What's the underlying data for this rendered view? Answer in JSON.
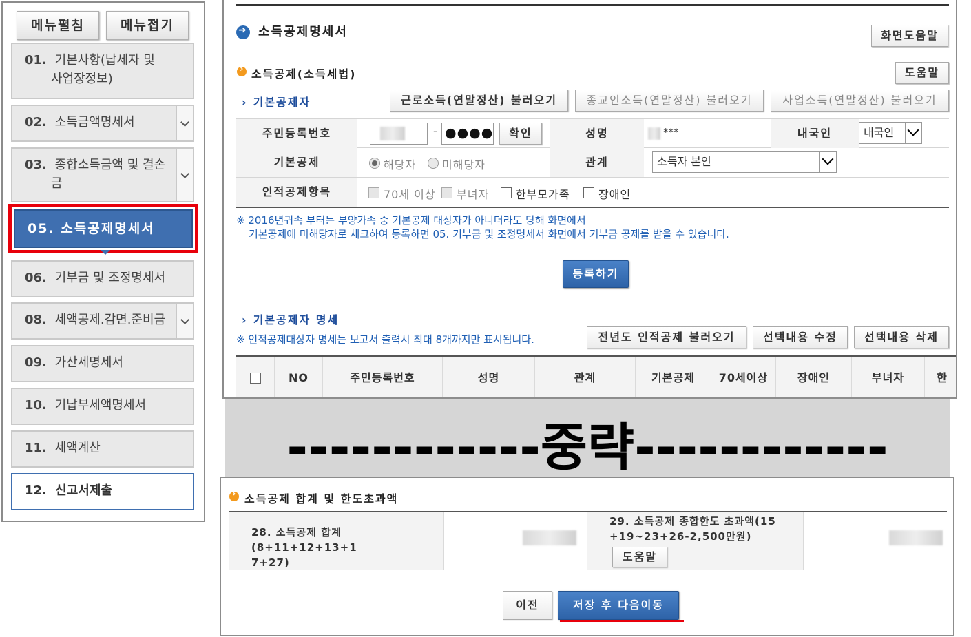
{
  "menu": {
    "open_label": "메뉴펼침",
    "close_label": "메뉴접기",
    "items": [
      {
        "num": "01.",
        "line1": "기본사항(납세자 및",
        "line2": "사업장정보)"
      },
      {
        "num": "02.",
        "label": "소득금액명세서"
      },
      {
        "num": "03.",
        "line1": "종합소득금액 및 결손",
        "line2": "금"
      },
      {
        "num": "05.",
        "label": "소득공제명세서"
      },
      {
        "num": "06.",
        "label": "기부금 및 조정명세서"
      },
      {
        "num": "08.",
        "label": "세액공제.감면.준비금"
      },
      {
        "num": "09.",
        "label": "가산세명세서"
      },
      {
        "num": "10.",
        "label": "기납부세액명세서"
      },
      {
        "num": "11.",
        "label": "세액계산"
      },
      {
        "num": "12.",
        "label": "신고서제출"
      }
    ]
  },
  "header": {
    "title": "소득공제명세서",
    "help_label": "화면도움말"
  },
  "section_income": {
    "title": "소득공제(소득세법)",
    "help_label": "도움말"
  },
  "basic": {
    "title": "기본공제자",
    "load_buttons": [
      "근로소득(연말정산) 불러오기",
      "종교인소득(연말정산) 불러오기",
      "사업소득(연말정산) 불러오기"
    ],
    "rrn_label": "주민등록번호",
    "rrn_dash": "-",
    "rrn_masked": "●●●●",
    "confirm_label": "확인",
    "name_label": "성명",
    "name_masked": "***",
    "nationality_label": "내국인",
    "nationality_value": "내국인",
    "basic_deduction_label": "기본공제",
    "radio_yes": "해당자",
    "radio_no": "미해당자",
    "relation_label": "관계",
    "relation_value": "소득자 본인",
    "personal_label": "인적공제항목",
    "checks": [
      "70세 이상",
      "부녀자",
      "한부모가족",
      "장애인"
    ],
    "note_line1": "※ 2016년귀속 부터는 부양가족 중 기본공제 대상자가 아니더라도 당해 화면에서",
    "note_line2": "기본공제에 미해당자로 체크하여 등록하면 05. 기부금 및 조정명세서 화면에서 기부금 공제를 받을 수 있습니다.",
    "register_label": "등록하기"
  },
  "detail": {
    "title": "기본공제자 명세",
    "note": "※ 인적공제대상자 명세는 보고서 출력시 최대 8개까지만 표시됩니다.",
    "buttons": [
      "전년도 인적공제 불러오기",
      "선택내용 수정",
      "선택내용 삭제"
    ],
    "columns": [
      "NO",
      "주민등록번호",
      "성명",
      "관계",
      "기본공제",
      "70세이상",
      "장애인",
      "부녀자",
      "한"
    ]
  },
  "omitted": {
    "text": "------------중략------------"
  },
  "summary": {
    "title": "소득공제 합계 및 한도초과액",
    "item28_line1": "28. 소득공제 합계(8+11+12+13+1",
    "item28_line2": "7+27)",
    "item29_line1": "29. 소득공제 종합한도 초과액(15",
    "item29_line2": "+19~23+26-2,500만원)",
    "help_label": "도움말"
  },
  "footer": {
    "prev_label": "이전",
    "save_next_label": "저장 후 다음이동"
  },
  "colors": {
    "highlight": "#e8000b",
    "active_menu": "#3f6fb0",
    "section_title": "#1f4e9c",
    "note_text": "#1f5fb4",
    "section_dot": "#f39a1e"
  }
}
